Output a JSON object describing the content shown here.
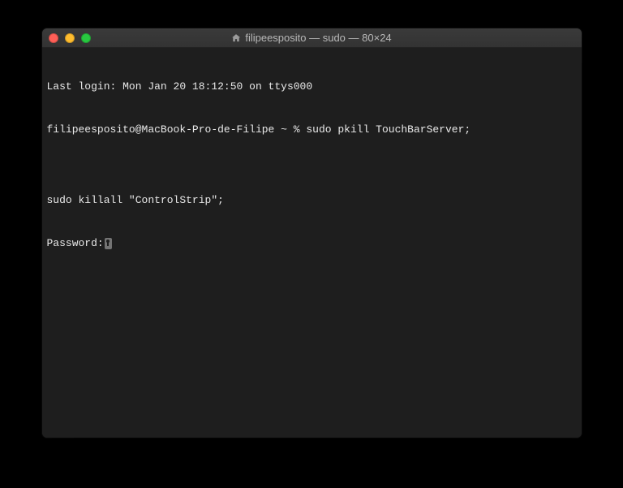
{
  "window": {
    "title": "filipeesposito — sudo — 80×24"
  },
  "terminal": {
    "line1": "Last login: Mon Jan 20 18:12:50 on ttys000",
    "line2": "filipeesposito@MacBook-Pro-de-Filipe ~ % sudo pkill TouchBarServer;",
    "line3": "",
    "line4": "sudo killall \"ControlStrip\";",
    "line5": "Password:"
  }
}
